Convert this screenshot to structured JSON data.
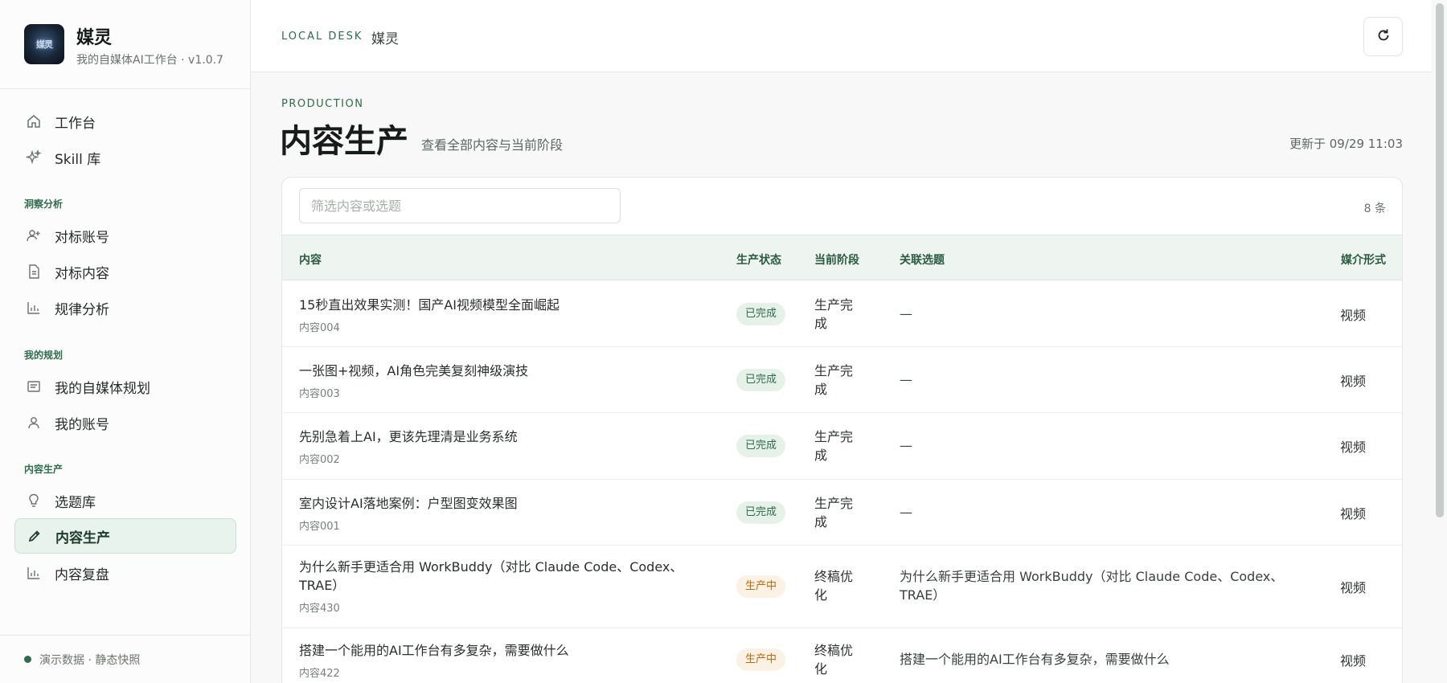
{
  "brand": {
    "name": "媒灵",
    "subtitle": "我的自媒体AI工作台 · v1.0.7",
    "logo_icon": "app-logo"
  },
  "sidebar": {
    "top_items": [
      {
        "label": "工作台",
        "icon": "home-icon"
      },
      {
        "label": "Skill 库",
        "icon": "sparkle-icon"
      }
    ],
    "sections": [
      {
        "title": "洞察分析",
        "items": [
          {
            "label": "对标账号",
            "icon": "user-plus-icon"
          },
          {
            "label": "对标内容",
            "icon": "document-icon"
          },
          {
            "label": "规律分析",
            "icon": "bar-chart-icon"
          }
        ]
      },
      {
        "title": "我的规划",
        "items": [
          {
            "label": "我的自媒体规划",
            "icon": "list-box-icon"
          },
          {
            "label": "我的账号",
            "icon": "user-icon"
          }
        ]
      },
      {
        "title": "内容生产",
        "items": [
          {
            "label": "选题库",
            "icon": "lightbulb-icon"
          },
          {
            "label": "内容生产",
            "icon": "pencil-icon",
            "active": true
          },
          {
            "label": "内容复盘",
            "icon": "bar-chart-icon"
          }
        ]
      }
    ],
    "footer": "演示数据 · 静态快照",
    "footer_status_color": "#2f6b4c"
  },
  "topbar": {
    "kicker": "LOCAL DESK",
    "crumb": "媒灵",
    "refresh_icon": "refresh-icon"
  },
  "page": {
    "eyebrow": "PRODUCTION",
    "title": "内容生产",
    "subtitle": "查看全部内容与当前阶段",
    "updated": "更新于 09/29 11:03"
  },
  "table": {
    "filter_placeholder": "筛选内容或选题",
    "count": "8 条",
    "headers": {
      "content": "内容",
      "status": "生产状态",
      "stage": "当前阶段",
      "topic": "关联选题",
      "media": "媒介形式"
    },
    "rows": [
      {
        "title": "15秒直出效果实测！国产AI视频模型全面崛起",
        "id": "内容004",
        "status": "已完成",
        "status_kind": "done",
        "stage": "生产完成",
        "topic": "—",
        "media": "视频"
      },
      {
        "title": "一张图+视频，AI角色完美复刻神级演技",
        "id": "内容003",
        "status": "已完成",
        "status_kind": "done",
        "stage": "生产完成",
        "topic": "—",
        "media": "视频"
      },
      {
        "title": "先别急着上AI，更该先理清是业务系统",
        "id": "内容002",
        "status": "已完成",
        "status_kind": "done",
        "stage": "生产完成",
        "topic": "—",
        "media": "视频"
      },
      {
        "title": "室内设计AI落地案例：户型图变效果图",
        "id": "内容001",
        "status": "已完成",
        "status_kind": "done",
        "stage": "生产完成",
        "topic": "—",
        "media": "视频"
      },
      {
        "title": "为什么新手更适合用 WorkBuddy（对比 Claude Code、Codex、TRAE）",
        "id": "内容430",
        "status": "生产中",
        "status_kind": "prog",
        "stage": "终稿优化",
        "topic": "为什么新手更适合用 WorkBuddy（对比 Claude Code、Codex、TRAE）",
        "media": "视频"
      },
      {
        "title": "搭建一个能用的AI工作台有多复杂，需要做什么",
        "id": "内容422",
        "status": "生产中",
        "status_kind": "prog",
        "stage": "终稿优化",
        "topic": "搭建一个能用的AI工作台有多复杂，需要做什么",
        "media": "视频"
      }
    ]
  }
}
